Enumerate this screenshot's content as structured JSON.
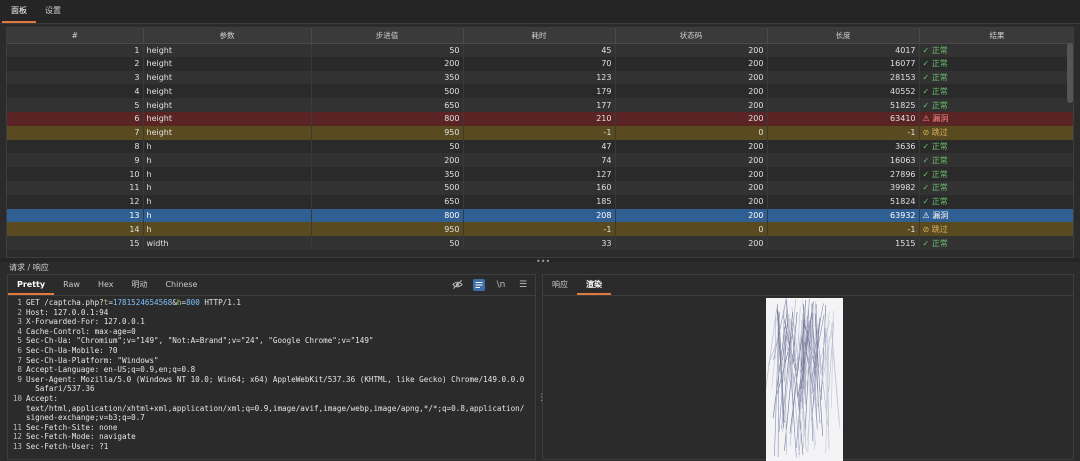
{
  "top_tabs": [
    "面板",
    "设置"
  ],
  "table": {
    "headers": [
      "#",
      "参数",
      "步进值",
      "耗时",
      "状态码",
      "长度",
      "结果"
    ],
    "rows": [
      {
        "n": "1",
        "param": "height",
        "step": "50",
        "time": "45",
        "status": "200",
        "len": "4017",
        "result": "✓ 正常",
        "kind": "ok"
      },
      {
        "n": "2",
        "param": "height",
        "step": "200",
        "time": "70",
        "status": "200",
        "len": "16077",
        "result": "✓ 正常",
        "kind": "ok"
      },
      {
        "n": "3",
        "param": "height",
        "step": "350",
        "time": "123",
        "status": "200",
        "len": "28153",
        "result": "✓ 正常",
        "kind": "ok"
      },
      {
        "n": "4",
        "param": "height",
        "step": "500",
        "time": "179",
        "status": "200",
        "len": "40552",
        "result": "✓ 正常",
        "kind": "ok"
      },
      {
        "n": "5",
        "param": "height",
        "step": "650",
        "time": "177",
        "status": "200",
        "len": "51825",
        "result": "✓ 正常",
        "kind": "ok"
      },
      {
        "n": "6",
        "param": "height",
        "step": "800",
        "time": "210",
        "status": "200",
        "len": "63410",
        "result": "⚠ 漏洞",
        "kind": "vuln"
      },
      {
        "n": "7",
        "param": "height",
        "step": "950",
        "time": "-1",
        "status": "0",
        "len": "-1",
        "result": "⊘ 跳过",
        "kind": "skip"
      },
      {
        "n": "8",
        "param": "h",
        "step": "50",
        "time": "47",
        "status": "200",
        "len": "3636",
        "result": "✓ 正常",
        "kind": "ok"
      },
      {
        "n": "9",
        "param": "h",
        "step": "200",
        "time": "74",
        "status": "200",
        "len": "16063",
        "result": "✓ 正常",
        "kind": "ok"
      },
      {
        "n": "10",
        "param": "h",
        "step": "350",
        "time": "127",
        "status": "200",
        "len": "27896",
        "result": "✓ 正常",
        "kind": "ok"
      },
      {
        "n": "11",
        "param": "h",
        "step": "500",
        "time": "160",
        "status": "200",
        "len": "39982",
        "result": "✓ 正常",
        "kind": "ok"
      },
      {
        "n": "12",
        "param": "h",
        "step": "650",
        "time": "185",
        "status": "200",
        "len": "51824",
        "result": "✓ 正常",
        "kind": "ok"
      },
      {
        "n": "13",
        "param": "h",
        "step": "800",
        "time": "208",
        "status": "200",
        "len": "63932",
        "result": "⚠ 漏洞",
        "kind": "sel"
      },
      {
        "n": "14",
        "param": "h",
        "step": "950",
        "time": "-1",
        "status": "0",
        "len": "-1",
        "result": "⊘ 跳过",
        "kind": "skip"
      },
      {
        "n": "15",
        "param": "width",
        "step": "50",
        "time": "33",
        "status": "200",
        "len": "1515",
        "result": "✓ 正常",
        "kind": "ok"
      }
    ]
  },
  "panel_label": "请求 / 响应",
  "request_tabs": [
    "Pretty",
    "Raw",
    "Hex",
    "明动",
    "Chinese"
  ],
  "toolbar": {
    "wrap_label": "\\n",
    "menu_icon": "menu-icon",
    "hide_icon": "eye-off-icon",
    "format_icon": "format-icon"
  },
  "request_lines": [
    {
      "no": "1",
      "parts": [
        {
          "t": "GET /captcha.php?",
          "c": "k"
        },
        {
          "t": "t",
          "c": "pn"
        },
        {
          "t": "=",
          "c": "k"
        },
        {
          "t": "1781524654568",
          "c": "pv"
        },
        {
          "t": "&",
          "c": "k"
        },
        {
          "t": "h",
          "c": "pn"
        },
        {
          "t": "=",
          "c": "k"
        },
        {
          "t": "800",
          "c": "pv"
        },
        {
          "t": " HTTP/1.1",
          "c": "k"
        }
      ]
    },
    {
      "no": "2",
      "parts": [
        {
          "t": "Host: 127.0.0.1:94",
          "c": "k"
        }
      ]
    },
    {
      "no": "3",
      "parts": [
        {
          "t": "X-Forwarded-For: 127.0.0.1",
          "c": "k"
        }
      ]
    },
    {
      "no": "4",
      "parts": [
        {
          "t": "Cache-Control: max-age=0",
          "c": "k"
        }
      ]
    },
    {
      "no": "5",
      "parts": [
        {
          "t": "Sec-Ch-Ua: \"Chromium\";v=\"149\", \"Not:A=Brand\";v=\"24\", \"Google Chrome\";v=\"149\"",
          "c": "k"
        }
      ]
    },
    {
      "no": "6",
      "parts": [
        {
          "t": "Sec-Ch-Ua-Mobile: ?0",
          "c": "k"
        }
      ]
    },
    {
      "no": "7",
      "parts": [
        {
          "t": "Sec-Ch-Ua-Platform: \"Windows\"",
          "c": "k"
        }
      ]
    },
    {
      "no": "8",
      "parts": [
        {
          "t": "Accept-Language: en-US;q=0.9,en;q=0.8",
          "c": "k"
        }
      ]
    },
    {
      "no": "9",
      "parts": [
        {
          "t": "User-Agent: Mozilla/5.0 (Windows NT 10.0; Win64; x64) AppleWebKit/537.36 (KHTML, like Gecko) Chrome/149.0.0.0",
          "c": "k"
        }
      ]
    },
    {
      "no": "",
      "parts": [
        {
          "t": "  Safari/537.36",
          "c": "k"
        }
      ]
    },
    {
      "no": "10",
      "parts": [
        {
          "t": "Accept:",
          "c": "k"
        }
      ]
    },
    {
      "no": "",
      "parts": [
        {
          "t": "text/html,application/xhtml+xml,application/xml;q=0.9,image/avif,image/webp,image/apng,*/*;q=0.8,application/",
          "c": "k"
        }
      ]
    },
    {
      "no": "",
      "parts": [
        {
          "t": "signed-exchange;v=b3;q=0.7",
          "c": "k"
        }
      ]
    },
    {
      "no": "11",
      "parts": [
        {
          "t": "Sec-Fetch-Site: none",
          "c": "k"
        }
      ]
    },
    {
      "no": "12",
      "parts": [
        {
          "t": "Sec-Fetch-Mode: navigate",
          "c": "k"
        }
      ]
    },
    {
      "no": "13",
      "parts": [
        {
          "t": "Sec-Fetch-User: ?1",
          "c": "k"
        }
      ]
    }
  ],
  "response_tabs": [
    "响应",
    "渲染"
  ]
}
